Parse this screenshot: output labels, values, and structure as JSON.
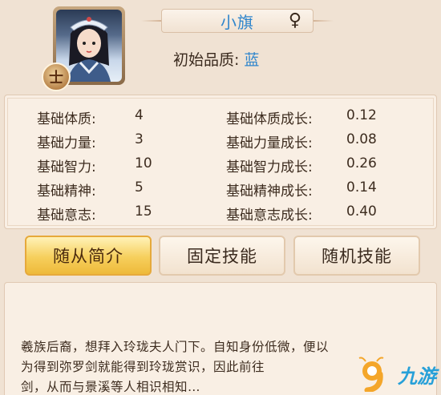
{
  "header": {
    "name": "小旗",
    "gender_symbol": "♀",
    "quality_label": "初始品质:",
    "quality_value": "蓝",
    "rank_badge": "士"
  },
  "stats": [
    {
      "label": "基础体质:",
      "value": "4",
      "growth_label": "基础体质成长:",
      "growth_value": "0.12"
    },
    {
      "label": "基础力量:",
      "value": "3",
      "growth_label": "基础力量成长:",
      "growth_value": "0.08"
    },
    {
      "label": "基础智力:",
      "value": "10",
      "growth_label": "基础智力成长:",
      "growth_value": "0.26"
    },
    {
      "label": "基础精神:",
      "value": "5",
      "growth_label": "基础精神成长:",
      "growth_value": "0.14"
    },
    {
      "label": "基础意志:",
      "value": "15",
      "growth_label": "基础意志成长:",
      "growth_value": "0.40"
    }
  ],
  "tabs": [
    {
      "label": "随从简介",
      "active": true
    },
    {
      "label": "固定技能",
      "active": false
    },
    {
      "label": "随机技能",
      "active": false
    }
  ],
  "description": {
    "lines": [
      "羲族后裔，想拜入玲珑夫人门下。自知身份低微，便以",
      "为得到弥罗剑就能得到玲珑赏识，因此前往",
      "剑，从而与景溪等人相识相知…"
    ]
  },
  "watermark": {
    "text": "九游",
    "icon": "nine-game-logo-icon"
  },
  "colors": {
    "name_blue": "#2e85cc",
    "tab_active": "#f6cf5c",
    "background": "#f0e2d3"
  }
}
